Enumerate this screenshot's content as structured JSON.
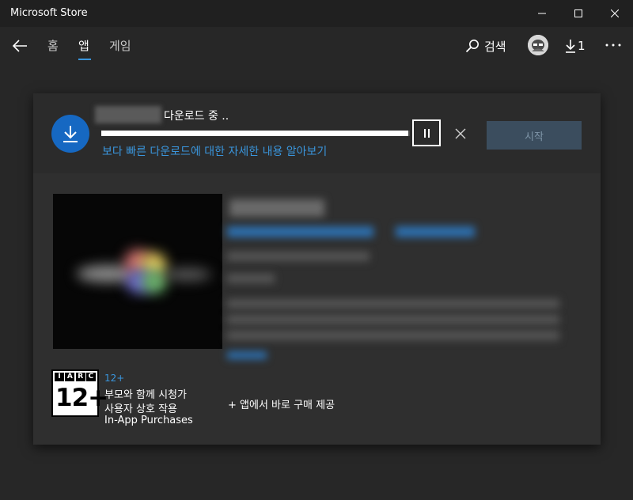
{
  "window": {
    "title": "Microsoft Store"
  },
  "nav": {
    "tabs": [
      {
        "label": "홈",
        "active": false
      },
      {
        "label": "앱",
        "active": true
      },
      {
        "label": "게임",
        "active": false
      }
    ],
    "search_label": "검색",
    "downloads_count": "1",
    "accent_color": "#3a96dd"
  },
  "download": {
    "status": "다운로드 중 ..",
    "progress": 0.995,
    "faster_link": "보다 빠른 다운로드에 대한 자세한 내용 알아보기",
    "start_label": "시작"
  },
  "rating": {
    "iarc_letters": [
      "I",
      "A",
      "R",
      "C"
    ],
    "iarc_age": "12+",
    "age_label": "12+",
    "descriptor": "부모와 함께 시청가",
    "interaction": "사용자 상호 작용",
    "purchases": "In-App Purchases"
  },
  "offer": {
    "iap_note": "+ 앱에서 바로 구매 제공"
  },
  "icons": [
    "back-arrow-icon",
    "search-icon",
    "download-icon",
    "more-icon",
    "pause-icon",
    "close-icon"
  ]
}
